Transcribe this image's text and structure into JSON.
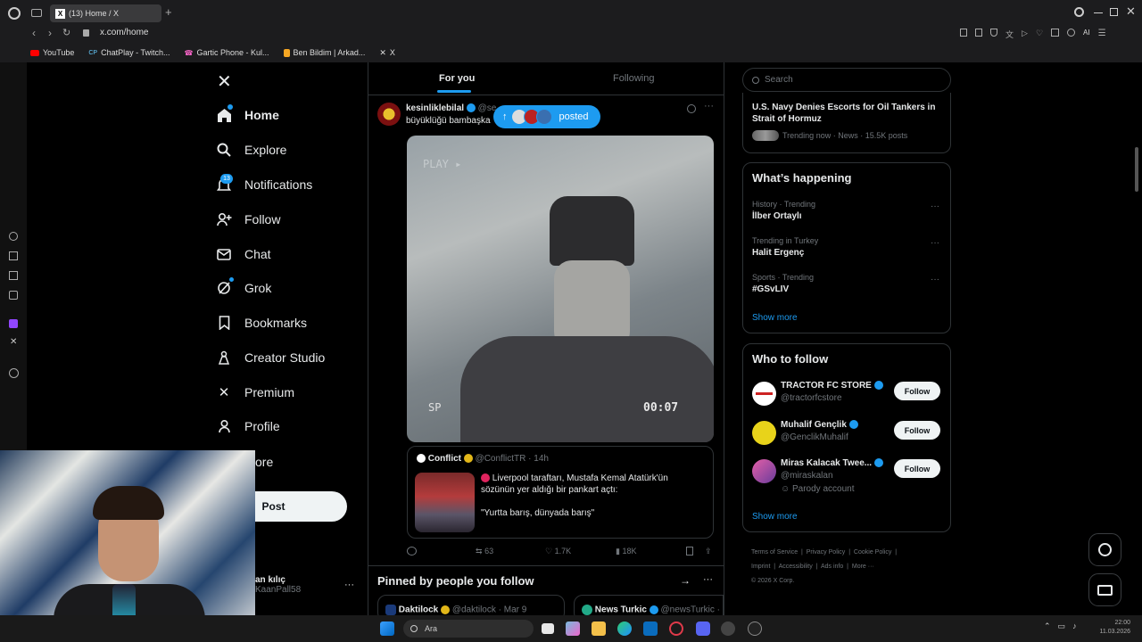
{
  "browser": {
    "tab_title": "(13) Home / X",
    "url": "x.com/home",
    "bookmarks": [
      "YouTube",
      "ChatPlay - Twitch...",
      "Gartic Phone - Kul...",
      "Ben Bildim | Arkad...",
      "X"
    ]
  },
  "nav": {
    "items": [
      {
        "label": "Home",
        "icon": "home-icon"
      },
      {
        "label": "Explore",
        "icon": "search-icon"
      },
      {
        "label": "Notifications",
        "icon": "bell-icon",
        "badge": "13"
      },
      {
        "label": "Follow",
        "icon": "person-add-icon"
      },
      {
        "label": "Chat",
        "icon": "mail-icon"
      },
      {
        "label": "Grok",
        "icon": "grok-icon"
      },
      {
        "label": "Bookmarks",
        "icon": "bookmark-icon"
      },
      {
        "label": "Creator Studio",
        "icon": "creator-icon"
      },
      {
        "label": "Premium",
        "icon": "x-logo-icon"
      },
      {
        "label": "Profile",
        "icon": "person-icon"
      },
      {
        "label": "ore",
        "icon": "more-icon"
      }
    ],
    "post_label": "Post",
    "account": {
      "name": "an kılıç",
      "handle": "KaanPall58"
    }
  },
  "feed": {
    "tabs": [
      "For you",
      "Following"
    ],
    "tweet": {
      "author": "kesinliklebilal",
      "handle": "@se",
      "text": "büyüklüğü bambaşka",
      "posted_pill": "posted",
      "video_overlay_play": "PLAY ▸",
      "video_overlay_sp": "SP",
      "video_time": "00:07",
      "quote": {
        "author": "Conflict",
        "handle": "@ConflictTR · 14h",
        "text_line1": "Liverpool taraftarı, Mustafa Kemal Atatürk'ün",
        "text_line2": "sözünün yer aldığı bir pankart açtı:",
        "text_line3": "\"Yurtta barış, dünyada barış\""
      },
      "stats": {
        "retweets": "63",
        "likes": "1.7K",
        "views": "18K"
      }
    },
    "pinned_title": "Pinned by people you follow",
    "pinned": [
      {
        "author": "Daktilock",
        "handle": "@daktilock · Mar 9"
      },
      {
        "author": "News Turkic",
        "handle": "@newsTurkic ·"
      }
    ]
  },
  "right": {
    "search_placeholder": "Search",
    "top_news": {
      "title_line1": "U.S. Navy Denies Escorts for Oil Tankers in",
      "title_line2": "Strait of Hormuz",
      "meta": "Trending now · News · 15.5K posts"
    },
    "happening_title": "What’s happening",
    "trends": [
      {
        "category": "History · Trending",
        "name": "İlber Ortaylı"
      },
      {
        "category": "Trending in Turkey",
        "name": "Halit Ergenç"
      },
      {
        "category": "Sports · Trending",
        "name": "#GSvLIV"
      }
    ],
    "show_more": "Show more",
    "who_title": "Who to follow",
    "who": [
      {
        "name": "TRACTOR FC STORE",
        "handle": "@tractorfcstore"
      },
      {
        "name": "Muhalif Gençlik",
        "handle": "@GenclikMuhalif"
      },
      {
        "name": "Miras Kalacak Twee...",
        "handle": "@miraskalan",
        "extra": "Parody account"
      }
    ],
    "follow_label": "Follow",
    "footer": [
      "Terms of Service",
      "Privacy Policy",
      "Cookie Policy",
      "Imprint",
      "Accessibility",
      "Ads info",
      "More ···",
      "© 2026 X Corp."
    ]
  },
  "taskbar": {
    "search_label": "Ara",
    "time": "22:00",
    "date": "11.03.2026"
  }
}
